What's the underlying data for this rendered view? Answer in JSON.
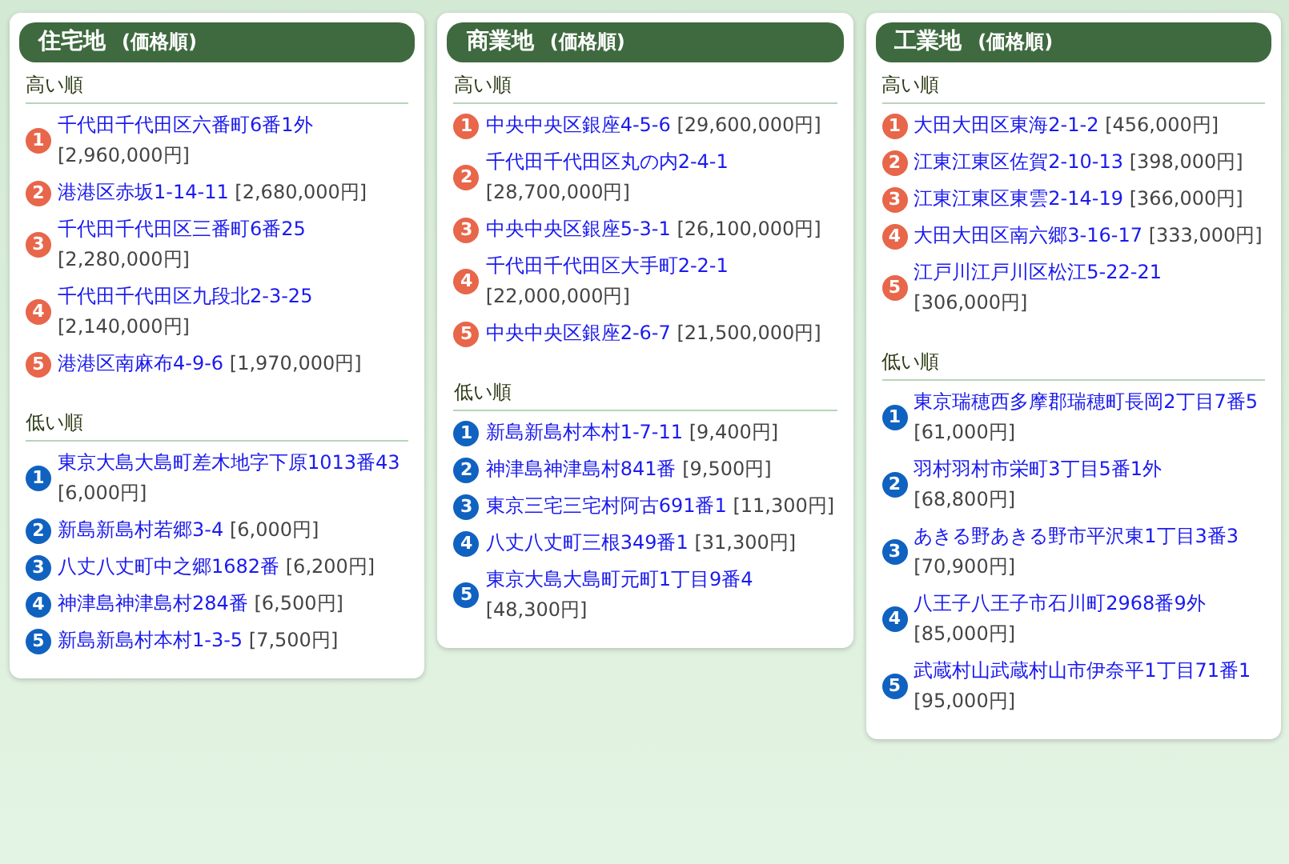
{
  "columns": [
    {
      "title": "住宅地",
      "subtitle": "(価格順)",
      "sections": [
        {
          "kind": "high",
          "heading": "高い順",
          "items": [
            {
              "rank": "1",
              "address": "千代田千代田区六番町6番1外",
              "price": "[2,960,000円]"
            },
            {
              "rank": "2",
              "address": "港港区赤坂1-14-11",
              "price": "[2,680,000円]"
            },
            {
              "rank": "3",
              "address": "千代田千代田区三番町6番25",
              "price": "[2,280,000円]"
            },
            {
              "rank": "4",
              "address": "千代田千代田区九段北2-3-25",
              "price": "[2,140,000円]"
            },
            {
              "rank": "5",
              "address": "港港区南麻布4-9-6",
              "price": "[1,970,000円]"
            }
          ]
        },
        {
          "kind": "low",
          "heading": "低い順",
          "items": [
            {
              "rank": "1",
              "address": "東京大島大島町差木地字下原1013番43",
              "price": "[6,000円]"
            },
            {
              "rank": "2",
              "address": "新島新島村若郷3-4",
              "price": "[6,000円]"
            },
            {
              "rank": "3",
              "address": "八丈八丈町中之郷1682番",
              "price": "[6,200円]"
            },
            {
              "rank": "4",
              "address": "神津島神津島村284番",
              "price": "[6,500円]"
            },
            {
              "rank": "5",
              "address": "新島新島村本村1-3-5",
              "price": "[7,500円]"
            }
          ]
        }
      ]
    },
    {
      "title": "商業地",
      "subtitle": "(価格順)",
      "sections": [
        {
          "kind": "high",
          "heading": "高い順",
          "items": [
            {
              "rank": "1",
              "address": "中央中央区銀座4-5-6",
              "price": "[29,600,000円]"
            },
            {
              "rank": "2",
              "address": "千代田千代田区丸の内2-4-1",
              "price": "[28,700,000円]"
            },
            {
              "rank": "3",
              "address": "中央中央区銀座5-3-1",
              "price": "[26,100,000円]"
            },
            {
              "rank": "4",
              "address": "千代田千代田区大手町2-2-1",
              "price": "[22,000,000円]"
            },
            {
              "rank": "5",
              "address": "中央中央区銀座2-6-7",
              "price": "[21,500,000円]"
            }
          ]
        },
        {
          "kind": "low",
          "heading": "低い順",
          "items": [
            {
              "rank": "1",
              "address": "新島新島村本村1-7-11",
              "price": "[9,400円]"
            },
            {
              "rank": "2",
              "address": "神津島神津島村841番",
              "price": "[9,500円]"
            },
            {
              "rank": "3",
              "address": "東京三宅三宅村阿古691番1",
              "price": "[11,300円]"
            },
            {
              "rank": "4",
              "address": "八丈八丈町三根349番1",
              "price": "[31,300円]"
            },
            {
              "rank": "5",
              "address": "東京大島大島町元町1丁目9番4",
              "price": "[48,300円]"
            }
          ]
        }
      ]
    },
    {
      "title": "工業地",
      "subtitle": "(価格順)",
      "sections": [
        {
          "kind": "high",
          "heading": "高い順",
          "items": [
            {
              "rank": "1",
              "address": "大田大田区東海2-1-2",
              "price": "[456,000円]"
            },
            {
              "rank": "2",
              "address": "江東江東区佐賀2-10-13",
              "price": "[398,000円]"
            },
            {
              "rank": "3",
              "address": "江東江東区東雲2-14-19",
              "price": "[366,000円]"
            },
            {
              "rank": "4",
              "address": "大田大田区南六郷3-16-17",
              "price": "[333,000円]"
            },
            {
              "rank": "5",
              "address": "江戸川江戸川区松江5-22-21",
              "price": "[306,000円]"
            }
          ]
        },
        {
          "kind": "low",
          "heading": "低い順",
          "items": [
            {
              "rank": "1",
              "address": "東京瑞穂西多摩郡瑞穂町長岡2丁目7番5",
              "price": "[61,000円]"
            },
            {
              "rank": "2",
              "address": "羽村羽村市栄町3丁目5番1外",
              "price": "[68,800円]"
            },
            {
              "rank": "3",
              "address": "あきる野あきる野市平沢東1丁目3番3",
              "price": "[70,900円]"
            },
            {
              "rank": "4",
              "address": "八王子八王子市石川町2968番9外",
              "price": "[85,000円]"
            },
            {
              "rank": "5",
              "address": "武蔵村山武蔵村山市伊奈平1丁目71番1",
              "price": "[95,000円]"
            }
          ]
        }
      ]
    }
  ]
}
